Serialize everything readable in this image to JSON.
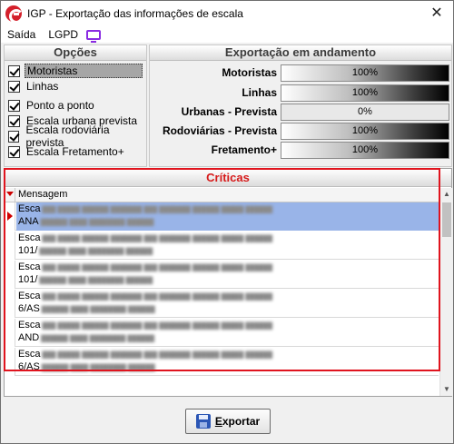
{
  "window": {
    "title": "IGP - Exportação das informações de escala",
    "close_glyph": "✕",
    "app_icon": "igp-logo-icon"
  },
  "menu": {
    "items": [
      {
        "label": "Saída"
      },
      {
        "label": "LGPD"
      }
    ],
    "lgpd_icon": "monitor-icon",
    "lgpd_icon_color": "#8a2be2"
  },
  "options_panel": {
    "title": "Opções",
    "items": [
      {
        "label": "Motoristas",
        "checked": true,
        "selected": true
      },
      {
        "label": "Linhas",
        "checked": true,
        "selected": false
      },
      {
        "label": "Ponto a ponto",
        "checked": true,
        "selected": false
      },
      {
        "label": "Escala urbana prevista",
        "checked": true,
        "selected": false
      },
      {
        "label": "Escala rodoviária prevista",
        "checked": true,
        "selected": false
      },
      {
        "label": "Escala Fretamento+",
        "checked": true,
        "selected": false
      }
    ]
  },
  "export_panel": {
    "title": "Exportação em andamento",
    "items": [
      {
        "label": "Motoristas",
        "progress_text": "100%",
        "progress": 1.0
      },
      {
        "label": "Linhas",
        "progress_text": "100%",
        "progress": 1.0
      },
      {
        "label": "Urbanas - Prevista",
        "progress_text": "0%",
        "progress": 0.0
      },
      {
        "label": "Rodoviárias - Prevista",
        "progress_text": "100%",
        "progress": 1.0
      },
      {
        "label": "Fretamento+",
        "progress_text": "100%",
        "progress": 1.0
      }
    ]
  },
  "criticas": {
    "title": "Críticas",
    "title_color": "#d61a1a",
    "highlight_color": "#e0141e",
    "column_header": "Mensagem",
    "rows": [
      {
        "line1": "Esca",
        "line2": "ANA",
        "current": true
      },
      {
        "line1": "Esca",
        "line2": "101/",
        "current": false
      },
      {
        "line1": "Esca",
        "line2": "101/",
        "current": false
      },
      {
        "line1": "Esca",
        "line2": "6/AS",
        "current": false
      },
      {
        "line1": "Esca",
        "line2": "AND",
        "current": false
      },
      {
        "line1": "Esca",
        "line2": "6/AS",
        "current": false
      }
    ]
  },
  "export_button": {
    "label_prefix": "E",
    "label_rest": "xportar",
    "icon": "save-disk-icon"
  }
}
